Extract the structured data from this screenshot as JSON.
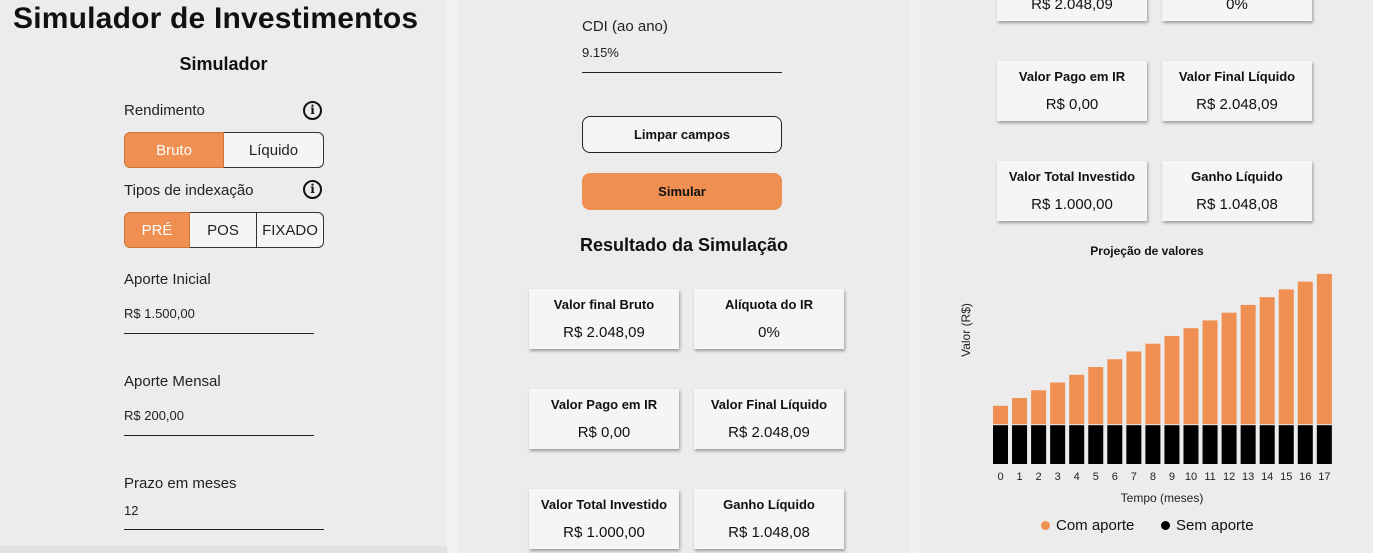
{
  "app_title": "Simulador de Investimentos",
  "form": {
    "heading": "Simulador",
    "rendimento": {
      "label": "Rendimento",
      "options": [
        "Bruto",
        "Líquido"
      ],
      "selected": 0
    },
    "indexacao": {
      "label": "Tipos de indexação",
      "options": [
        "PRÉ",
        "POS",
        "FIXADO"
      ],
      "selected": 0
    },
    "aporte_inicial": {
      "label": "Aporte Inicial",
      "value": "R$ 1.500,00"
    },
    "aporte_mensal": {
      "label": "Aporte Mensal",
      "value": "R$ 200,00"
    },
    "prazo": {
      "label": "Prazo em meses",
      "value": "12"
    },
    "cdi": {
      "label": "CDI (ao ano)",
      "value": "9.15%"
    },
    "clear_label": "Limpar campos",
    "submit_label": "Simular"
  },
  "result": {
    "heading": "Resultado da Simulação",
    "cards": [
      {
        "title": "Valor final Bruto",
        "value": "R$ 2.048,09"
      },
      {
        "title": "Alíquota do IR",
        "value": "0%"
      },
      {
        "title": "Valor Pago em IR",
        "value": "R$ 0,00"
      },
      {
        "title": "Valor Final Líquido",
        "value": "R$ 2.048,09"
      },
      {
        "title": "Valor Total Investido",
        "value": "R$ 1.000,00"
      },
      {
        "title": "Ganho Líquido",
        "value": "R$ 1.048,08"
      }
    ]
  },
  "colors": {
    "accent": "#ef8f52",
    "panel": "#ececec",
    "card": "#f5f5f5",
    "sem_aporte": "#000000"
  },
  "chart_data": {
    "type": "bar",
    "title": "Projeção de valores",
    "xlabel": "Tempo (meses)",
    "ylabel": "Valor (R$)",
    "categories": [
      "0",
      "1",
      "2",
      "3",
      "4",
      "5",
      "6",
      "7",
      "8",
      "9",
      "10",
      "11",
      "12",
      "13",
      "14",
      "15",
      "16",
      "17"
    ],
    "series": [
      {
        "name": "Com aporte",
        "color": "#ef8f52",
        "values": [
          1500,
          1700,
          1900,
          2100,
          2300,
          2500,
          2700,
          2900,
          3100,
          3300,
          3500,
          3700,
          3900,
          4100,
          4300,
          4500,
          4700,
          4900
        ]
      },
      {
        "name": "Sem aporte",
        "color": "#000000",
        "values": [
          1000,
          1000,
          1000,
          1000,
          1000,
          1000,
          1000,
          1000,
          1000,
          1000,
          1000,
          1000,
          1000,
          1000,
          1000,
          1000,
          1000,
          1000
        ]
      }
    ],
    "stacked": true,
    "ylim": [
      0,
      5000
    ],
    "grid": false,
    "legend": "bottom"
  }
}
